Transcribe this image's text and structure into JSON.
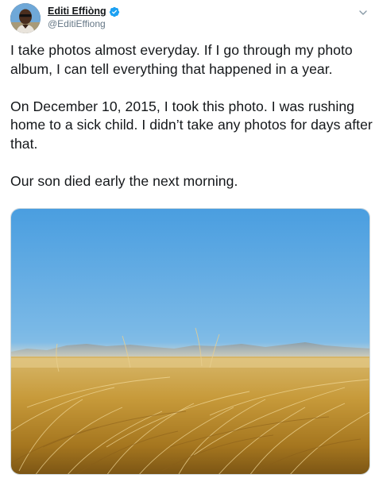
{
  "author": {
    "display_name": "Editi Effiòng",
    "handle": "@EditiEffiong",
    "verified": true,
    "avatar_icon": "profile-photo"
  },
  "menu": {
    "icon": "chevron-down-icon"
  },
  "tweet": {
    "paragraphs": [
      "I take photos almost everyday. If I go through my photo album, I can tell everything that happened in a year.",
      "On December 10, 2015, I took this photo. I was rushing home to a sick child. I didn’t take any photos for days after that.",
      "Our son died early the next morning."
    ]
  },
  "media": {
    "description_icon": "landscape-photo"
  },
  "colors": {
    "text": "#14171a",
    "secondary": "#657786",
    "verified_blue": "#1da1f2",
    "sky_top": "#4a9ee0",
    "sky_horizon": "#cfe2ea",
    "grass": "#c99a3a"
  }
}
